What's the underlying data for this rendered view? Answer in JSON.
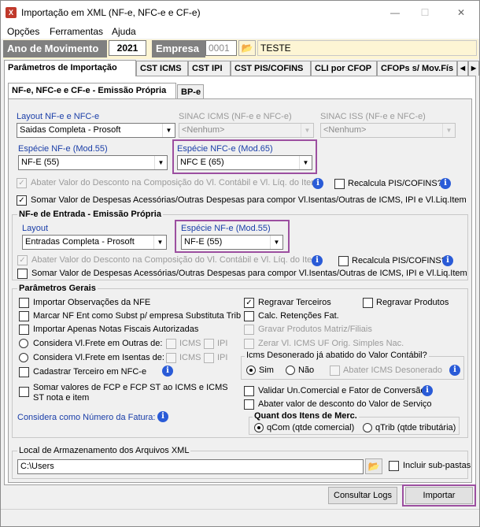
{
  "window": {
    "title": "Importação em XML (NF-e, NFC-e e CF-e)",
    "app_icon": "X"
  },
  "menu": [
    "Opções",
    "Ferramentas",
    "Ajuda"
  ],
  "header": {
    "ano_label": "Ano de Movimento",
    "ano_value": "2021",
    "empresa_label": "Empresa",
    "empresa_code": "0001",
    "empresa_name": "TESTE"
  },
  "tabs": [
    "Parâmetros de Importação",
    "CST ICMS",
    "CST IPI",
    "CST PIS/COFINS",
    "CLI por CFOP",
    "CFOPs s/ Mov.Fís"
  ],
  "subtabs": [
    "NF-e, NFC-e e CF-e - Emissão Própria",
    "BP-e"
  ],
  "emissao": {
    "layout_label": "Layout NF-e e NFC-e",
    "layout_value": "Saidas Completa - Prosoft",
    "sinac_icms_label": "SINAC ICMS (NF-e e NFC-e)",
    "sinac_icms_value": "<Nenhum>",
    "sinac_iss_label": "SINAC ISS (NF-e e NFC-e)",
    "sinac_iss_value": "<Nenhum>",
    "especie_nfe_label": "Espécie NF-e (Mod.55)",
    "especie_nfe_value": "NF-E (55)",
    "especie_nfce_label": "Espécie NFC-e (Mod.65)",
    "especie_nfce_value": "NFC E (65)",
    "abater_label": "Abater Valor do Desconto na Composição do Vl. Contábil e Vl. Líq. do Item",
    "recalcula_label": "Recalcula PIS/COFINS?",
    "somar_label": "Somar Valor de Despesas Acessórias/Outras Despesas para compor Vl.Isentas/Outras de ICMS, IPI e Vl.Liq.Item"
  },
  "entrada": {
    "title": "NF-e de Entrada - Emissão Própria",
    "layout_label": "Layout",
    "layout_value": "Entradas Completa - Prosoft",
    "especie_label": "Espécie NF-e (Mod.55)",
    "especie_value": "NF-E (55)",
    "abater_label": "Abater Valor do Desconto na Composição do Vl. Contábil e Vl. Líq. do Item",
    "recalcula_label": "Recalcula PIS/COFINS?",
    "somar_label": "Somar Valor de Despesas Acessórias/Outras Despesas para compor Vl.Isentas/Outras de ICMS, IPI e Vl.Liq.Item"
  },
  "gerais": {
    "title": "Parâmetros Gerais",
    "importar_obs": "Importar Observações da NFE",
    "marcar_nf": "Marcar NF Ent como Subst p/ empresa Substituta Trib",
    "importar_apenas": "Importar Apenas Notas Fiscais Autorizadas",
    "frete_outras": "Considera Vl.Frete em Outras de:",
    "frete_isentas": "Considera Vl.Frete em Isentas de:",
    "icms": "ICMS",
    "ipi": "IPI",
    "cadastrar": "Cadastrar Terceiro em NFC-e",
    "somar_fcp": "Somar valores de FCP e FCP ST ao ICMS e ICMS ST nota e item",
    "considera_fatura": "Considera como Número da Fatura:",
    "regravar_terceiros": "Regravar Terceiros",
    "regravar_terceiros_check": "✓",
    "regravar_produtos": "Regravar Produtos",
    "calc_retencoes": "Calc. Retenções Fat.",
    "gravar_produtos": "Gravar Produtos Matriz/Filiais",
    "zerar_icms": "Zerar Vl. ICMS UF Orig. Simples Nac.",
    "icms_des_title": "Icms Desonerado já abatido do Valor Contábil?",
    "sim": "Sim",
    "nao": "Não",
    "abater_icms_des": "Abater ICMS Desonerado",
    "validar_un": "Validar Un.Comercial e Fator de Conversão",
    "abater_desconto_serv": "Abater valor de desconto do Valor de Serviço",
    "quant_title": "Quant dos Itens de Merc.",
    "qcom": "qCom (qtde comercial)",
    "qtrib": "qTrib (qtde tributária)"
  },
  "local": {
    "title": "Local de Armazenamento dos Arquivos XML",
    "path": "C:\\Users",
    "incluir": "Incluir sub-pastas"
  },
  "buttons": {
    "logs": "Consultar Logs",
    "importar": "Importar"
  },
  "icons": {
    "info": "i",
    "folder": "📂",
    "check": "✓",
    "arrow": "▼",
    "minimize": "—",
    "maximize": "☐",
    "close": "✕"
  },
  "colors": {
    "highlight": "#9c4fa0",
    "label_blue": "#1a3ea8",
    "header_bg": "#fdf5d4"
  }
}
